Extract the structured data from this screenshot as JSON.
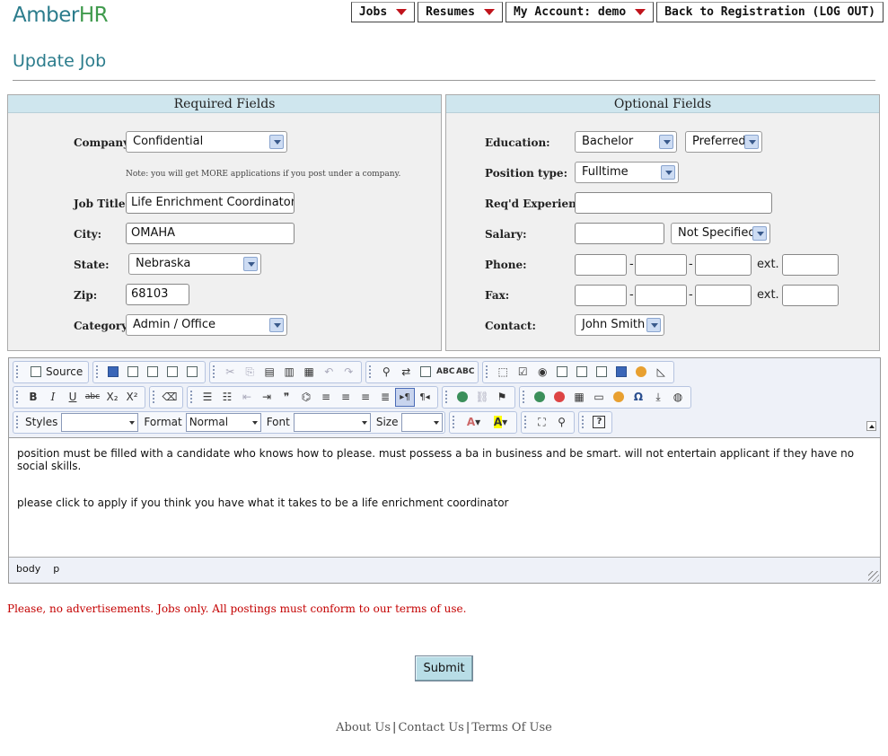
{
  "app": {
    "logo_a": "Amber",
    "logo_b": "HR"
  },
  "nav": {
    "jobs": "Jobs",
    "resumes": "Resumes",
    "account": "My Account: demo",
    "logout": "Back to Registration (LOG OUT)"
  },
  "page_title": "Update Job",
  "required": {
    "heading": "Required Fields",
    "company_label": "Company:",
    "company_value": "Confidential",
    "company_note": "Note: you will get MORE applications if you post under a company.",
    "title_label": "Job Title:",
    "title_value": "Life Enrichment Coordinator",
    "city_label": "City:",
    "city_value": "OMAHA",
    "state_label": "State:",
    "state_value": "Nebraska",
    "zip_label": "Zip:",
    "zip_value": "68103",
    "category_label": "Category:",
    "category_value": "Admin / Office"
  },
  "optional": {
    "heading": "Optional Fields",
    "education_label": "Education:",
    "education_value": "Bachelor",
    "education_pref": "Preferred",
    "position_label": "Position type:",
    "position_value": "Fulltime",
    "experience_label": "Req'd Experience:",
    "experience_value": "",
    "salary_label": "Salary:",
    "salary_value": "",
    "salary_spec": "Not Specified",
    "phone_label": "Phone:",
    "fax_label": "Fax:",
    "dash": "-",
    "ext_label": "ext.",
    "contact_label": "Contact:",
    "contact_value": "John Smith"
  },
  "editor": {
    "source_label": "Source",
    "styles_label": "Styles",
    "styles_value": "",
    "format_label": "Format",
    "format_value": "Normal",
    "font_label": "Font",
    "font_value": "",
    "size_label": "Size",
    "size_value": "",
    "paragraphs": [
      "position must be filled with a candidate who knows how to please.  must possess a ba in business and be smart.  will not entertain applicant if they have no social skills.",
      "please click to apply if you think you have what it takes to be a life enrichment coordinator"
    ],
    "path": [
      "body",
      "p"
    ],
    "glyphs": {
      "bold": "B",
      "italic": "I",
      "underline": "U",
      "strike": "abc",
      "sub": "X₂",
      "sup": "X²",
      "quote": "❞",
      "pilcrow_l": "▸¶",
      "pilcrow_r": "¶◂",
      "omega": "Ω",
      "help": "?",
      "spell": "ABC",
      "find": "🔍"
    }
  },
  "footer": {
    "warning": "Please, no advertisements. Jobs only. All postings must conform to our terms of use.",
    "submit": "Submit",
    "about": "About Us",
    "contact": "Contact Us",
    "terms": "Terms Of Use",
    "sep": "|"
  }
}
